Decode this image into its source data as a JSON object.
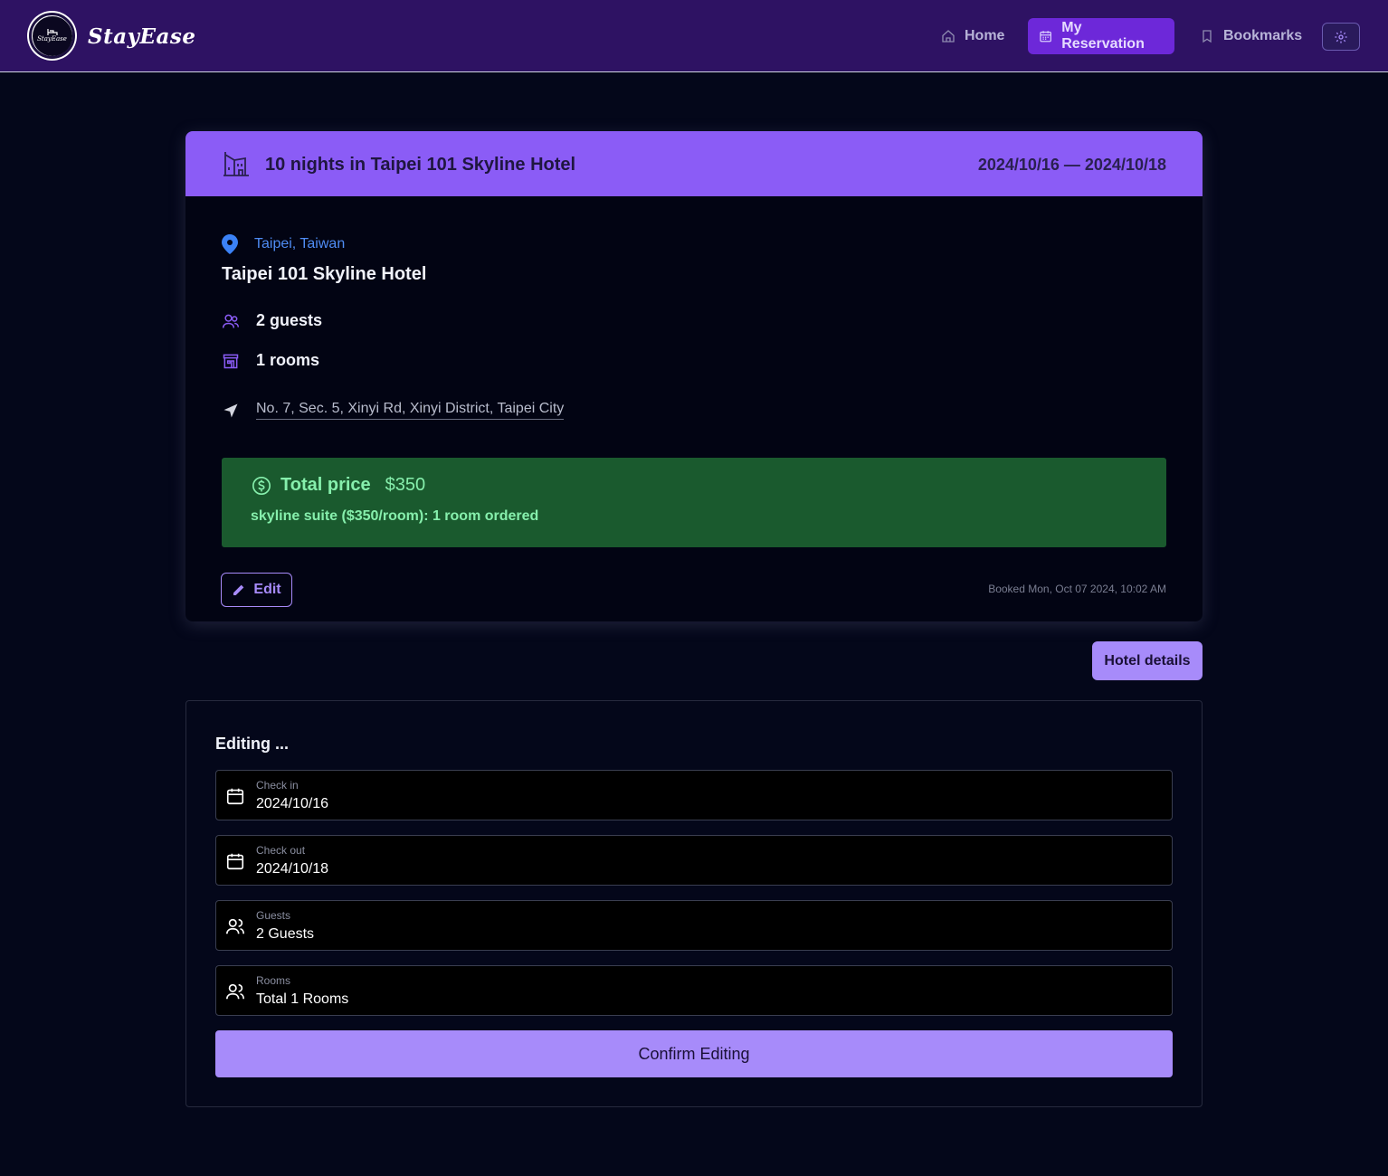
{
  "header": {
    "brand": "StayEase",
    "logo_text": "StayEase",
    "nav": {
      "home": "Home",
      "reservation": "My Reservation",
      "bookmarks": "Bookmarks"
    },
    "icons": {
      "home": "home-icon",
      "reservation": "calendar-icon",
      "bookmarks": "bookmark-icon",
      "settings": "gear-icon"
    }
  },
  "reservation": {
    "title": "10 nights in Taipei 101 Skyline Hotel",
    "dates": "2024/10/16 — 2024/10/18",
    "location": "Taipei, Taiwan",
    "hotel_name": "Taipei 101 Skyline Hotel",
    "guests": "2 guests",
    "rooms": "1 rooms",
    "address": "No. 7, Sec. 5, Xinyi Rd, Xinyi District, Taipei City",
    "price": {
      "label": "Total price",
      "amount": "$350",
      "detail": "skyline suite ($350/room): 1 room ordered"
    },
    "edit_label": "Edit",
    "booked_at": "Booked Mon, Oct 07 2024, 10:02 AM"
  },
  "hotel_details_label": "Hotel details",
  "editing": {
    "title": "Editing ...",
    "fields": [
      {
        "label": "Check in",
        "value": "2024/10/16",
        "icon": "calendar-icon"
      },
      {
        "label": "Check out",
        "value": "2024/10/18",
        "icon": "calendar-icon"
      },
      {
        "label": "Guests",
        "value": "2 Guests",
        "icon": "users-icon"
      },
      {
        "label": "Rooms",
        "value": "Total 1 Rooms",
        "icon": "users-icon"
      }
    ],
    "confirm_label": "Confirm Editing"
  },
  "colors": {
    "nav_bg": "#2e1263",
    "accent": "#8b5cf6",
    "accent_light": "#a78bfa",
    "price_bg": "#1a5a2e",
    "price_text": "#86efac",
    "location": "#4f8cf3",
    "page_bg": "#04071a"
  }
}
